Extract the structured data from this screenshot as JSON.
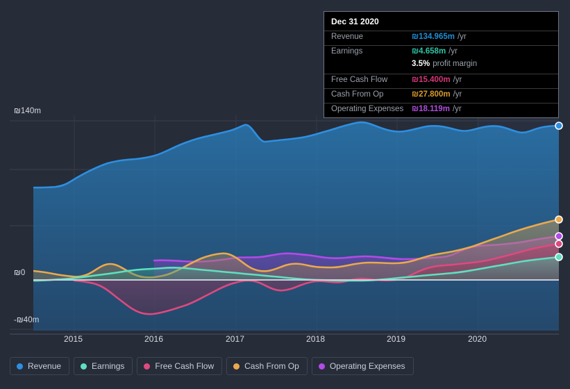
{
  "currency_symbol": "₪",
  "tooltip": {
    "title": "Dec 31 2020",
    "rows": [
      {
        "key": "Revenue",
        "value": "₪134.965m",
        "unit": "/yr",
        "color": "#1f8fd6"
      },
      {
        "key": "Earnings",
        "value": "₪4.658m",
        "unit": "/yr",
        "color": "#2ec4a6"
      },
      {
        "key": "",
        "value": "3.5%",
        "unit": "profit margin",
        "color": "#ffffff",
        "sub": true
      },
      {
        "key": "Free Cash Flow",
        "value": "₪15.400m",
        "unit": "/yr",
        "color": "#d6367a"
      },
      {
        "key": "Cash From Op",
        "value": "₪27.800m",
        "unit": "/yr",
        "color": "#d99b2e"
      },
      {
        "key": "Operating Expenses",
        "value": "₪18.119m",
        "unit": "/yr",
        "color": "#b14de0"
      }
    ]
  },
  "legend": {
    "items": [
      {
        "label": "Revenue",
        "color": "#2e8fe0"
      },
      {
        "label": "Earnings",
        "color": "#5fe0c0"
      },
      {
        "label": "Free Cash Flow",
        "color": "#dd4a7f"
      },
      {
        "label": "Cash From Op",
        "color": "#eaa94e"
      },
      {
        "label": "Operating Expenses",
        "color": "#b44ae8"
      }
    ]
  },
  "chart_data": {
    "type": "area",
    "title": "",
    "xlabel": "",
    "ylabel": "",
    "grid": true,
    "legend_position": "bottom",
    "currency": "₪",
    "units": "m",
    "ylim": [
      -40,
      140
    ],
    "y_ticks": [
      140,
      0,
      -40
    ],
    "y_tick_labels": [
      "₪140m",
      "₪0",
      "-₪40m"
    ],
    "x_ticks": [
      "2015",
      "2016",
      "2017",
      "2018",
      "2019",
      "2020"
    ],
    "x_range": [
      "2014-07",
      "2021-03"
    ],
    "forecast_start": "2020",
    "series": [
      {
        "name": "Revenue",
        "color": "#2e8fe0",
        "fill": "#1d4a70",
        "x": [
          "2014-07",
          "2014-10",
          "2015-01",
          "2015-04",
          "2015-07",
          "2015-10",
          "2016-01",
          "2016-04",
          "2016-07",
          "2016-10",
          "2017-01",
          "2017-04",
          "2017-07",
          "2017-10",
          "2018-01",
          "2018-04",
          "2018-07",
          "2018-10",
          "2019-01",
          "2019-04",
          "2019-07",
          "2019-10",
          "2020-01",
          "2020-04",
          "2020-07",
          "2020-10",
          "2020-12"
        ],
        "values": [
          81.5,
          81.5,
          83.0,
          88.0,
          93.5,
          97.5,
          99.0,
          100.5,
          104.0,
          107.5,
          110.0,
          115.5,
          119.0,
          120.0,
          120.5,
          120.0,
          120.5,
          124.0,
          128.5,
          131.5,
          129.0,
          128.0,
          130.0,
          133.5,
          134.5,
          131.0,
          134.965
        ]
      },
      {
        "name": "Operating Expenses",
        "color": "#b44ae8",
        "fill": "#6b3f9e",
        "x": [
          "2015-10",
          "2016-01",
          "2016-04",
          "2016-07",
          "2016-10",
          "2017-01",
          "2017-04",
          "2017-07",
          "2017-10",
          "2018-01",
          "2018-04",
          "2018-07",
          "2018-10",
          "2019-01",
          "2019-04",
          "2019-07",
          "2019-10",
          "2020-01",
          "2020-04",
          "2020-07",
          "2020-10",
          "2020-12"
        ],
        "values": [
          13.8,
          13.5,
          13.4,
          13.3,
          13.4,
          13.7,
          14.1,
          14.3,
          14.1,
          14.6,
          14.9,
          14.6,
          14.3,
          14.2,
          14.1,
          14.2,
          14.5,
          16.3,
          16.6,
          16.8,
          17.4,
          18.119
        ]
      },
      {
        "name": "Cash From Op",
        "color": "#eaa94e",
        "fill": "#8a6a3c",
        "x": [
          "2014-07",
          "2014-10",
          "2015-01",
          "2015-04",
          "2015-07",
          "2015-10",
          "2016-01",
          "2016-04",
          "2016-07",
          "2016-10",
          "2017-01",
          "2017-04",
          "2017-07",
          "2017-10",
          "2018-01",
          "2018-04",
          "2018-07",
          "2018-10",
          "2019-01",
          "2019-04",
          "2019-07",
          "2019-10",
          "2020-01",
          "2020-04",
          "2020-07",
          "2020-10",
          "2020-12"
        ],
        "values": [
          5.0,
          4.6,
          4.0,
          3.4,
          3.2,
          4.0,
          7.0,
          4.8,
          2.5,
          2.0,
          2.6,
          5.4,
          8.3,
          9.2,
          6.5,
          2.3,
          2.0,
          4.6,
          4.0,
          3.3,
          5.7,
          6.0,
          6.2,
          11.5,
          15.0,
          21.0,
          27.8
        ]
      },
      {
        "name": "Free Cash Flow",
        "color": "#dd4a7f",
        "fill": "#7d2a46",
        "x": [
          "2015-01",
          "2015-04",
          "2015-07",
          "2015-10",
          "2016-01",
          "2016-04",
          "2016-07",
          "2016-10",
          "2017-01",
          "2017-04",
          "2017-07",
          "2017-10",
          "2018-01",
          "2018-04",
          "2018-07",
          "2018-10",
          "2019-01",
          "2019-04",
          "2019-07",
          "2019-10",
          "2020-01",
          "2020-04",
          "2020-07",
          "2020-10",
          "2020-12"
        ],
        "values": [
          -0.5,
          -1.5,
          -5.0,
          -10.0,
          -18.0,
          -26.5,
          -24.0,
          -21.0,
          -18.5,
          -13.0,
          -8.0,
          -3.0,
          -0.5,
          -3.5,
          -7.0,
          -5.5,
          -3.0,
          -1.5,
          -2.5,
          -1.0,
          -0.8,
          4.0,
          6.8,
          10.0,
          15.4
        ]
      },
      {
        "name": "Earnings",
        "color": "#5fe0c0",
        "fill": "#2d6f63",
        "x": [
          "2014-07",
          "2014-10",
          "2015-01",
          "2015-04",
          "2015-07",
          "2015-10",
          "2016-01",
          "2016-04",
          "2016-07",
          "2016-10",
          "2017-01",
          "2017-04",
          "2017-07",
          "2017-10",
          "2018-01",
          "2018-04",
          "2018-07",
          "2018-10",
          "2019-01",
          "2019-04",
          "2019-07",
          "2019-10",
          "2020-01",
          "2020-04",
          "2020-07",
          "2020-10",
          "2020-12"
        ],
        "values": [
          -0.8,
          -0.5,
          -0.2,
          0.3,
          0.7,
          1.4,
          2.2,
          3.0,
          4.1,
          4.4,
          4.5,
          4.3,
          3.9,
          3.2,
          2.4,
          1.4,
          0.6,
          0.1,
          -0.4,
          -0.9,
          -1.1,
          -1.0,
          -0.6,
          0.9,
          2.4,
          3.4,
          4.658
        ]
      }
    ]
  }
}
